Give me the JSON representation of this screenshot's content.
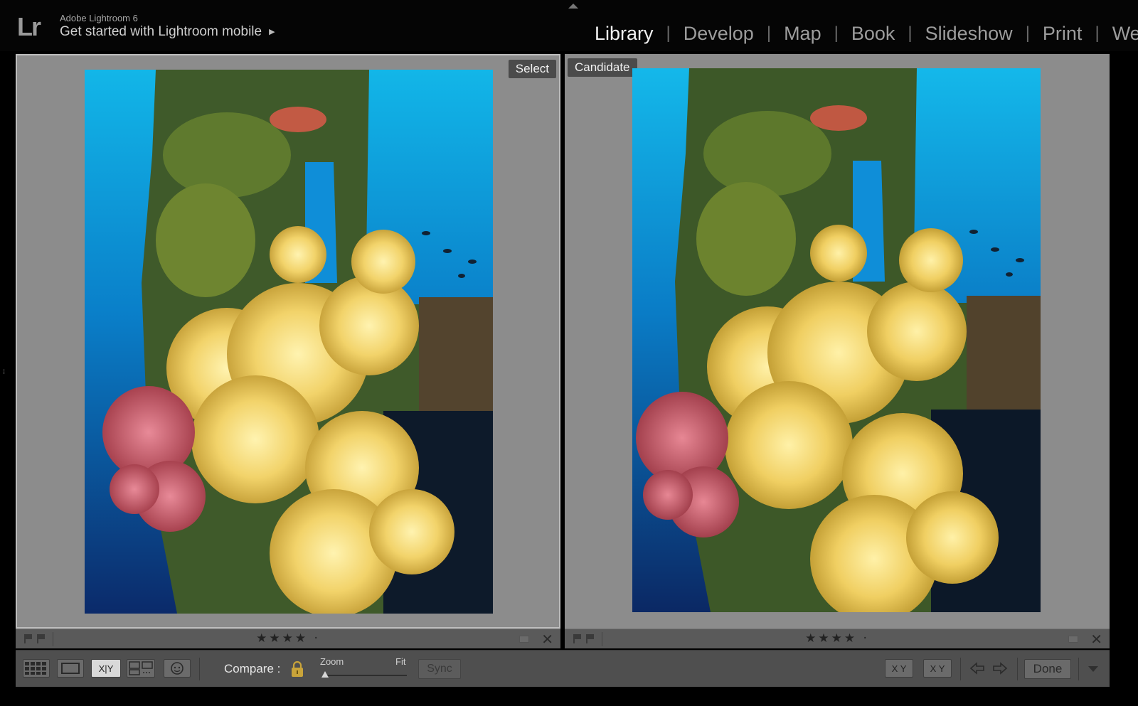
{
  "header": {
    "logo_text": "Lr",
    "app_name": "Adobe Lightroom 6",
    "mobile_link": "Get started with Lightroom mobile",
    "mobile_arrow": "▶"
  },
  "modules": [
    {
      "label": "Library",
      "active": true
    },
    {
      "label": "Develop",
      "active": false
    },
    {
      "label": "Map",
      "active": false
    },
    {
      "label": "Book",
      "active": false
    },
    {
      "label": "Slideshow",
      "active": false
    },
    {
      "label": "Print",
      "active": false
    },
    {
      "label": "Web",
      "active": false
    }
  ],
  "module_separator": "|",
  "panes": {
    "left": {
      "label": "Select",
      "stars": "★★★★ ·",
      "close": "✕"
    },
    "right": {
      "label": "Candidate",
      "stars": "★★★★ ·",
      "close": "✕"
    }
  },
  "toolbar": {
    "grid_icon": "grid-view-icon",
    "loupe_icon": "loupe-view-icon",
    "compare_text": "X|Y",
    "survey_icon": "survey-view-icon",
    "people_icon": "people-view-icon",
    "compare_label": "Compare :",
    "zoom_label": "Zoom",
    "fit_label": "Fit",
    "sync_label": "Sync",
    "swap_label": "X Y",
    "make_select_label": "X Y",
    "done_label": "Done"
  },
  "colors": {
    "active_module": "#f2f2f2",
    "inactive_module": "#9c9c9c",
    "pane_background": "#8c8c8c",
    "toolbar_background": "#4f4f4f"
  }
}
